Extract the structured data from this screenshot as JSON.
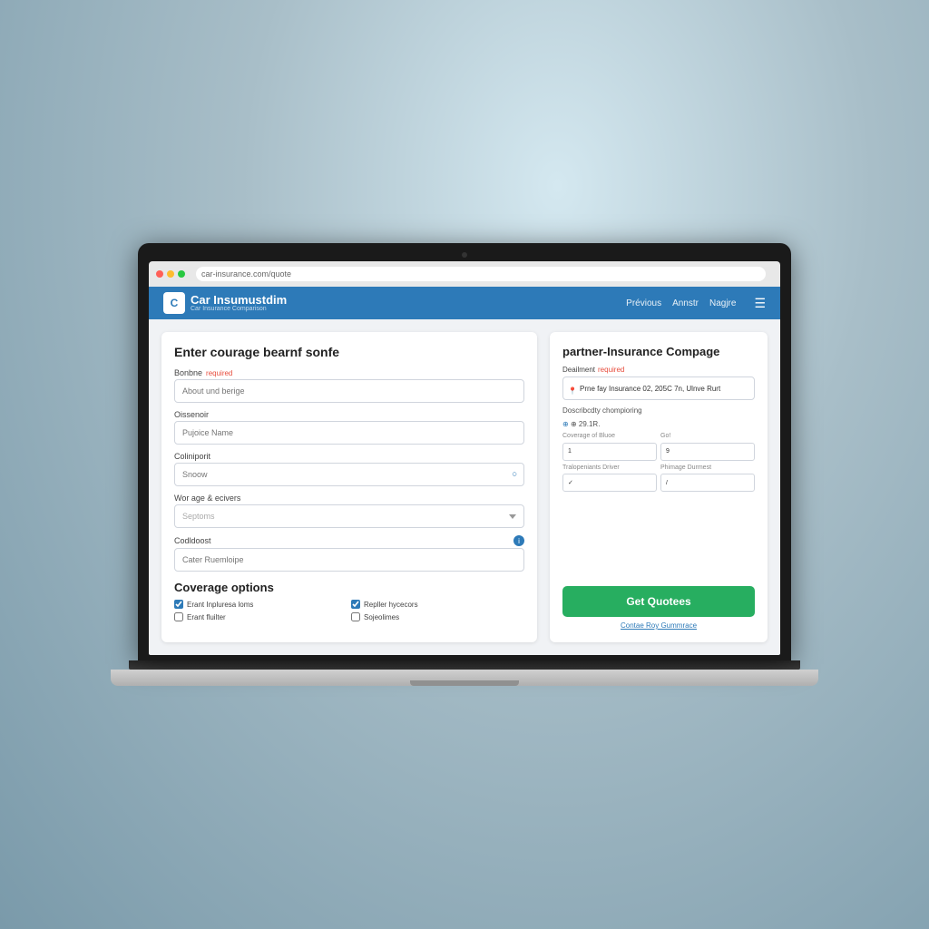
{
  "background": {
    "description": "Blurred office/cafe background"
  },
  "browser": {
    "url": "car-insurance.com/quote",
    "traffic_lights": [
      "red",
      "yellow",
      "green"
    ]
  },
  "navbar": {
    "logo_text": "C",
    "brand": "Car Insumustdim",
    "sub": "Car Insurance Comparison",
    "links": [
      "Prévious",
      "Annstr",
      "Nagjre"
    ],
    "hamburger": "☰"
  },
  "left_panel": {
    "title": "Enter courage bearnf sonfe",
    "fields": [
      {
        "label": "Bonbne",
        "required": true,
        "placeholder": "About und berige",
        "type": "text"
      },
      {
        "label": "Oissenoir",
        "required": false,
        "placeholder": "Pujoice Name",
        "type": "text"
      },
      {
        "label": "Coliniporit",
        "required": false,
        "placeholder": "Snoow",
        "type": "text",
        "has_icon": true
      },
      {
        "label": "Wor age & ecivers",
        "required": false,
        "placeholder": "Septoms",
        "type": "select"
      },
      {
        "label": "Codldoost",
        "required": false,
        "placeholder": "Cater Ruemloipe",
        "type": "text",
        "has_badge": true
      }
    ],
    "coverage_title": "Coverage options",
    "coverage_items": [
      {
        "label": "Erant Inpluresa loms",
        "checked": true
      },
      {
        "label": "Repller hycecors",
        "checked": true
      },
      {
        "label": "Erant fluilter",
        "checked": false
      },
      {
        "label": "Sojeolimes",
        "checked": false
      }
    ]
  },
  "right_panel": {
    "title": "partner-Insurance Compage",
    "detail_label": "Deailment",
    "detail_required": true,
    "detail_input_value": "Prne fay Insurance 02, 205C 7n, Ulnve Rurt",
    "info_line1": "Doscribcdty chompioring",
    "info_line2": "⊕ 29.1R.",
    "row1": {
      "col1_label": "Coverage of Bluoe",
      "col1_input": "1",
      "col2_label": "Go!",
      "col2_input": "9"
    },
    "row2": {
      "col1_label": "Tralopeniants Driver",
      "col1_input": "✓",
      "col2_label": "Phimage Durmest",
      "col2_input": "/"
    },
    "button_label": "Get Quotees",
    "compare_label": "Contae Roy Gummrace"
  }
}
